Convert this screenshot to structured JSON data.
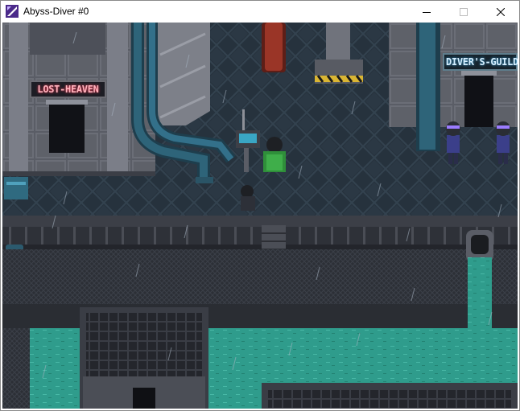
{
  "window": {
    "title": "Abyss-Diver #0",
    "controls": {
      "minimize": "minimize-icon",
      "maximize": "maximize-icon",
      "close": "close-icon"
    }
  },
  "scene": {
    "signs": {
      "left": "LOST-HEAVEN",
      "right": "DIVER'S-GUILD"
    },
    "colors": {
      "floor": "#26323d",
      "water": "#2f9c8c",
      "wall": "#5a5d66",
      "pipe": "#2a5466",
      "red_pipe": "#8a2f24"
    }
  }
}
